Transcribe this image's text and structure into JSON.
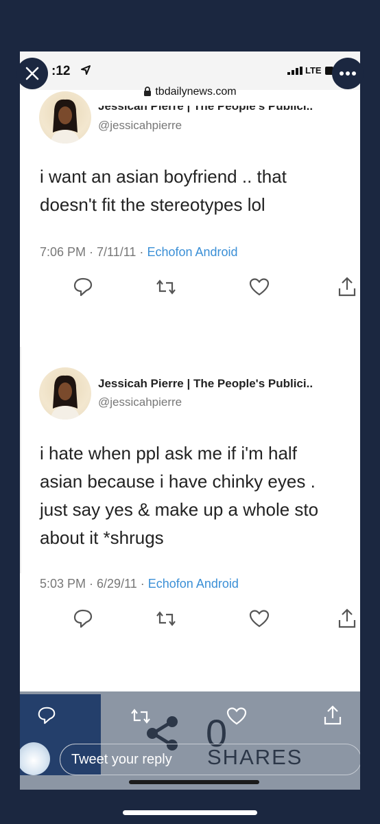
{
  "status_bar": {
    "time": ":12",
    "network": "LTE"
  },
  "browser": {
    "url": "tbdailynews.com"
  },
  "tweets": [
    {
      "name": "Jessicah Pierre | The People's Publici..",
      "handle": "@jessicahpierre",
      "text": "i want an asian boyfriend .. that\ndoesn't fit the stereotypes lol",
      "time": "7:06 PM · 7/11/11 ·",
      "source": "Echofon Android"
    },
    {
      "name": "Jessicah Pierre | The People's Publici..",
      "handle": "@jessicahpierre",
      "text": "i hate when ppl ask me if i'm half\nasian because i have chinky eyes .\njust say yes & make up a whole sto\nabout it *shrugs",
      "time": "5:03 PM · 6/29/11 ·",
      "source": "Echofon Android"
    }
  ],
  "share_overlay": {
    "count": "0",
    "label": "SHARES"
  },
  "reply": {
    "placeholder": "Tweet your reply"
  },
  "icons": {
    "close": "close-icon",
    "more": "more-icon",
    "reply": "reply-icon",
    "retweet": "retweet-icon",
    "like": "heart-icon",
    "share": "share-icon"
  },
  "colors": {
    "outer_background": "#1b2740",
    "link_blue": "#3a8fd6",
    "reply_bar": "#8c96a4",
    "reply_panel": "#243f6b"
  }
}
